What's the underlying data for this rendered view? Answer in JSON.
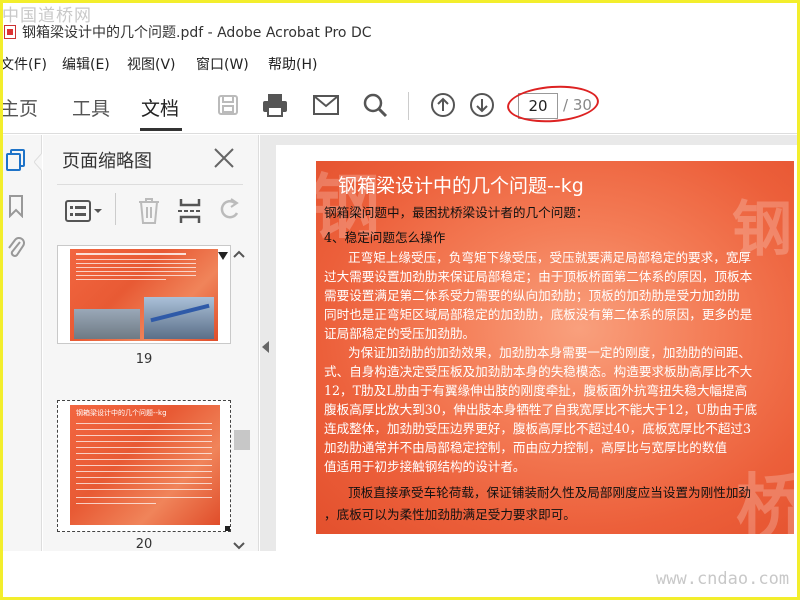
{
  "watermark_top": "中国道桥网",
  "watermark_bottom": "www.cndao.com",
  "window": {
    "title": "钢箱梁设计中的几个问题.pdf - Adobe Acrobat Pro DC"
  },
  "menu": [
    "文件(F)",
    "编辑(E)",
    "视图(V)",
    "窗口(W)",
    "帮助(H)"
  ],
  "nav_tabs": [
    "主页",
    "工具",
    "文档"
  ],
  "active_tab": "文档",
  "page_nav": {
    "current": "20",
    "total": "/ 30"
  },
  "panel": {
    "title": "页面缩略图"
  },
  "thumbnails": [
    {
      "label": "19"
    },
    {
      "label": "20",
      "title": "钢箱梁设计中的几个问题--kg",
      "selected": true
    }
  ],
  "slide": {
    "title": "钢箱梁设计中的几个问题--kg",
    "lines": [
      "钢箱梁问题中，最困扰桥梁设计者的几个问题：",
      "4、稳定问题怎么操作",
      "正弯矩上缘受压，负弯矩下缘受压，受压就要满足局部稳定的要求，宽厚",
      "过大需要设置加劲肋来保证局部稳定；由于顶板桥面第二体系的原因，顶板本",
      "需要设置满足第二体系受力需要的纵向加劲肋；顶板的加劲肋是受力加劲肋",
      "同时也是正弯矩区域局部稳定的加劲肋，底板没有第二体系的原因，更多的是",
      "证局部稳定的受压加劲肋。",
      "为保证加劲肋的加劲效果，加劲肋本身需要一定的刚度，加劲肋的间距、",
      "式、自身构造决定受压板及加劲肋本身的失稳模态。构造要求板肋高厚比不大",
      "12，T肋及L肋由于有翼缘伸出肢的刚度牵扯，腹板面外抗弯扭失稳大幅提高",
      "腹板高厚比放大到30，伸出肢本身牺牲了自我宽厚比不能大于12，U肋由于底",
      "连成整体，加劲肋受压边界更好，腹板高厚比不超过40，底板宽厚比不超过3",
      "加劲肋通常并不由局部稳定控制，而由应力控制，高厚比与宽厚比的数值",
      "值适用于初步接触钢结构的设计者。",
      "顶板直接承受车轮荷载，保证铺装耐久性及局部刚度应当设置为刚性加劲",
      "，底板可以为柔性加劲肋满足受力要求即可。"
    ]
  },
  "colors": {
    "slide_bg": "#ec5f3a",
    "highlight_ring": "#dd2222",
    "frame": "#f3ee2c"
  }
}
